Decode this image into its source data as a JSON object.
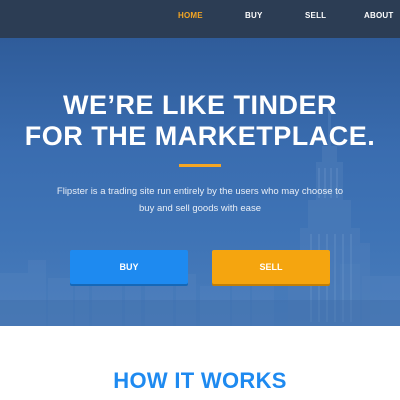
{
  "nav": {
    "items": [
      {
        "label": "HOME",
        "active": true
      },
      {
        "label": "BUY",
        "active": false
      },
      {
        "label": "SELL",
        "active": false
      },
      {
        "label": "ABOUT",
        "active": false
      }
    ]
  },
  "hero": {
    "title_line1": "WE’RE LIKE TINDER",
    "title_line2": "FOR THE MARKETPLACE.",
    "description": "Flipster is a trading site run entirely by the users who may choose to buy and sell goods with ease",
    "buy_label": "BUY",
    "sell_label": "SELL"
  },
  "how_it_works": {
    "title": "HOW IT WORKS"
  },
  "colors": {
    "nav_background": "#2c3d54",
    "accent_orange": "#f5a623",
    "accent_blue": "#1e8af0",
    "hero_overlay": "#3a6db0"
  }
}
